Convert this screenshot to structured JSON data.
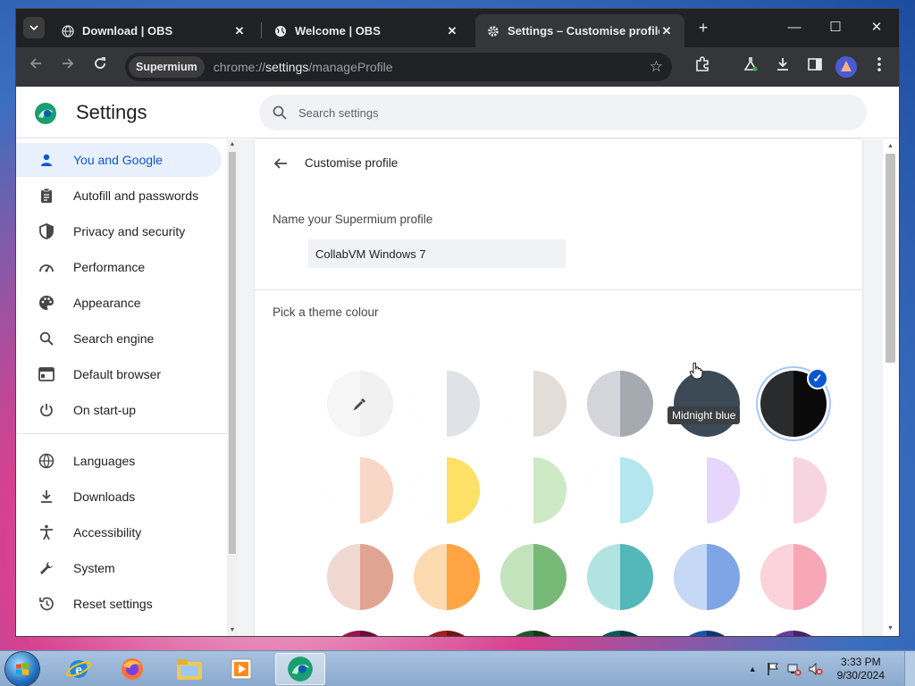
{
  "window": {
    "tabs": [
      {
        "title": "Download | OBS",
        "icon": "globe-icon",
        "close": "✕",
        "active": false
      },
      {
        "title": "Welcome | OBS",
        "icon": "globe-icon",
        "close": "✕",
        "active": false
      },
      {
        "title": "Settings – Customise profile",
        "icon": "gear-icon",
        "close": "✕",
        "active": true
      }
    ],
    "new_tab": "+",
    "controls": {
      "minimize": "—",
      "maximize": "☐",
      "close": "✕"
    }
  },
  "toolbar": {
    "chip": "Supermium",
    "url_scheme": "chrome://",
    "url_host": "settings",
    "url_path": "/manageProfile"
  },
  "settings": {
    "title": "Settings",
    "search_placeholder": "Search settings",
    "nav": [
      {
        "label": "You and Google",
        "icon": "person-icon",
        "active": true
      },
      {
        "label": "Autofill and passwords",
        "icon": "clipboard-icon",
        "active": false
      },
      {
        "label": "Privacy and security",
        "icon": "shield-icon",
        "active": false
      },
      {
        "label": "Performance",
        "icon": "gauge-icon",
        "active": false
      },
      {
        "label": "Appearance",
        "icon": "palette-icon",
        "active": false
      },
      {
        "label": "Search engine",
        "icon": "search-icon",
        "active": false
      },
      {
        "label": "Default browser",
        "icon": "browser-icon",
        "active": false
      },
      {
        "label": "On start-up",
        "icon": "power-icon",
        "active": false
      },
      {
        "label": "Languages",
        "icon": "globe-icon",
        "active": false
      },
      {
        "label": "Downloads",
        "icon": "download-icon",
        "active": false
      },
      {
        "label": "Accessibility",
        "icon": "accessibility-icon",
        "active": false
      },
      {
        "label": "System",
        "icon": "wrench-icon",
        "active": false
      },
      {
        "label": "Reset settings",
        "icon": "history-icon",
        "active": false
      }
    ],
    "customise": {
      "back_title": "Customise profile",
      "name_label": "Name your Supermium profile",
      "name_value": "CollabVM Windows 7",
      "theme_label": "Pick a theme colour",
      "hover_tooltip": "Midnight blue",
      "swatch_rows": [
        [
          {
            "l": "#f6f6f6",
            "r": "#f1f1f1",
            "type": "custom"
          },
          {
            "l": "#ffffff",
            "r": "#dfe3e8"
          },
          {
            "l": "#ffffff",
            "r": "#e3ddd7"
          },
          {
            "l": "#d4d5da",
            "r": "#a5a9b0"
          },
          {
            "l": "#3b4a55",
            "r": "#3b4a55"
          },
          {
            "l": "#2a2b2d",
            "r": "#0a0a0a",
            "selected": true
          }
        ],
        [
          {
            "l": "#ffffff",
            "r": "#f9d7c7"
          },
          {
            "l": "#ffffff",
            "r": "#fde066"
          },
          {
            "l": "#ffffff",
            "r": "#cde9c5"
          },
          {
            "l": "#ffffff",
            "r": "#b3e6ef"
          },
          {
            "l": "#ffffff",
            "r": "#e6d6fb"
          },
          {
            "l": "#ffffff",
            "r": "#f8d4e0"
          }
        ],
        [
          {
            "l": "#f0d8d0",
            "r": "#e0a592"
          },
          {
            "l": "#fedab0",
            "r": "#fea443"
          },
          {
            "l": "#c3e3bd",
            "r": "#78b978"
          },
          {
            "l": "#b2e3e3",
            "r": "#54b7b9"
          },
          {
            "l": "#c5d8f6",
            "r": "#7ea6e6"
          },
          {
            "l": "#fcd3da",
            "r": "#f7a7b6"
          }
        ],
        [
          {
            "l": "#9c1452",
            "r": "#6b0f3a"
          },
          {
            "l": "#a11f1c",
            "r": "#701515"
          },
          {
            "l": "#1f5a2a",
            "r": "#153a1d"
          },
          {
            "l": "#0d5a5c",
            "r": "#083b3c"
          },
          {
            "l": "#1a56a4",
            "r": "#103670"
          },
          {
            "l": "#6a3b9e",
            "r": "#432569"
          }
        ]
      ]
    }
  },
  "taskbar": {
    "apps": [
      "internet-explorer-icon",
      "firefox-icon",
      "file-explorer-icon",
      "media-player-icon",
      "supermium-icon"
    ],
    "clock_time": "3:33 PM",
    "clock_date": "9/30/2024"
  },
  "colors": {
    "accent": "#0b57d0",
    "nav_active_bg": "#e8f0fe",
    "tab_strip": "#202124",
    "toolbar": "#35363a"
  }
}
